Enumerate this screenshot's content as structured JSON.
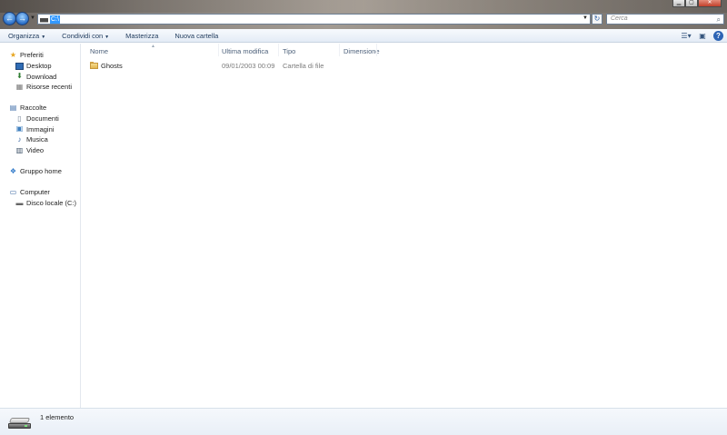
{
  "address": {
    "selected_text": "C:\\"
  },
  "search": {
    "placeholder": "Cerca"
  },
  "toolbar": {
    "items": [
      {
        "label": "Organizza",
        "has_menu": true
      },
      {
        "label": "Condividi con",
        "has_menu": true
      },
      {
        "label": "Masterizza",
        "has_menu": false
      },
      {
        "label": "Nuova cartella",
        "has_menu": false
      }
    ],
    "help_label": "?"
  },
  "navigation": {
    "favorites": {
      "label": "Preferiti",
      "icon": "star-icon",
      "items": [
        {
          "label": "Desktop",
          "icon": "desktop-icon"
        },
        {
          "label": "Download",
          "icon": "download-icon"
        },
        {
          "label": "Risorse recenti",
          "icon": "recent-places-icon"
        }
      ]
    },
    "libraries": {
      "label": "Raccolte",
      "icon": "library-icon",
      "items": [
        {
          "label": "Documenti",
          "icon": "documents-icon"
        },
        {
          "label": "Immagini",
          "icon": "pictures-icon"
        },
        {
          "label": "Musica",
          "icon": "music-icon"
        },
        {
          "label": "Video",
          "icon": "video-icon"
        }
      ]
    },
    "homegroup": {
      "label": "Gruppo home",
      "icon": "homegroup-icon"
    },
    "computer": {
      "label": "Computer",
      "icon": "computer-icon",
      "items": [
        {
          "label": "Disco locale (C:)",
          "icon": "local-disk-icon"
        }
      ]
    }
  },
  "columns": {
    "name": "Nome",
    "modified": "Ultima modifica",
    "type": "Tipo",
    "size": "Dimensione"
  },
  "files": [
    {
      "name": "Ghosts",
      "modified": "09/01/2003 00:09",
      "type": "Cartella di file",
      "size": "",
      "icon": "folder-icon"
    }
  ],
  "status": {
    "item_count": "1 elemento"
  },
  "colors": {
    "accent": "#3399ff",
    "toolbar_text": "#1e395b",
    "header_text": "#4c607a"
  }
}
